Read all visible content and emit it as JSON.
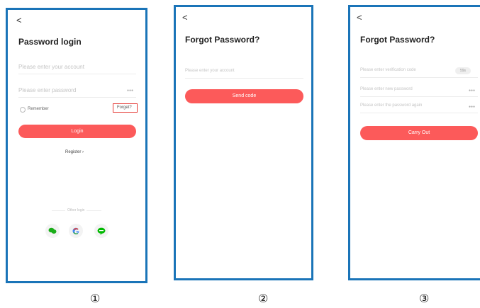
{
  "screens": [
    {
      "caption": "①",
      "back": "<",
      "title": "Password login",
      "account_placeholder": "Please enter your account",
      "password_placeholder": "Please enter password",
      "remember": "Remember",
      "forgot": "Forget?",
      "login": "Login",
      "register": "Register",
      "other_login": "Other login"
    },
    {
      "caption": "②",
      "back": "<",
      "title": "Forgot Password?",
      "account_placeholder": "Please enter your account",
      "send_code": "Send code"
    },
    {
      "caption": "③",
      "back": "<",
      "title": "Forgot Password?",
      "verification_placeholder": "Please enter verification code",
      "code_pill": "59s",
      "new_password_placeholder": "Please enter new password",
      "confirm_password_placeholder": "Please enter the password again",
      "carry_out": "Carry Out"
    }
  ],
  "colors": {
    "accent": "#fc5a5a",
    "frame": "#1a74b8",
    "wechat": "#1aad19",
    "line": "#00b900"
  },
  "icons": [
    "wechat-icon",
    "google-icon",
    "line-icon",
    "eye-icon"
  ]
}
